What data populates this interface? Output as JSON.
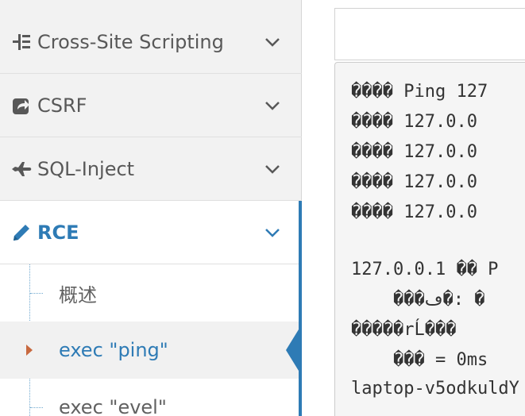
{
  "sidebar": {
    "items": [
      {
        "label": "Cross-Site Scripting",
        "icon": "list-tree-icon"
      },
      {
        "label": "CSRF",
        "icon": "share-icon"
      },
      {
        "label": "SQL-Inject",
        "icon": "plane-icon"
      },
      {
        "label": "RCE",
        "icon": "pencil-icon"
      }
    ],
    "submenu": [
      {
        "label": "概述"
      },
      {
        "label": "exec \"ping\""
      },
      {
        "label": "exec \"evel\""
      }
    ]
  },
  "output": {
    "lines": [
      "���� Ping 127",
      "���� 127.0.0",
      "���� 127.0.0",
      "���� 127.0.0",
      "���� 127.0.0",
      "127.0.0.1 �� P",
      "    ���ڡ�: �",
      "�����rĹ���",
      "    ��� = 0ms",
      "laptop-v5odkuldY"
    ]
  },
  "colors": {
    "accent": "#2e7bb5",
    "sidebar_bg": "#f2f2f2",
    "caret": "#c8693f"
  }
}
